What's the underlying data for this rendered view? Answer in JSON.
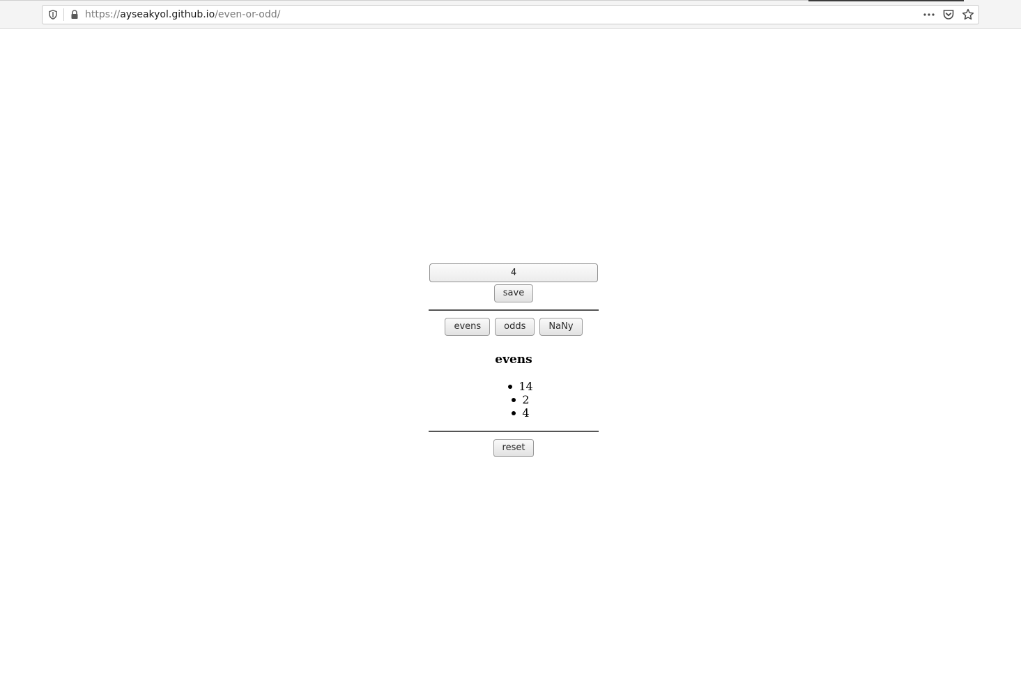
{
  "browser": {
    "url_scheme": "https://",
    "url_host": "ayseakyol.github.io",
    "url_path": "/even-or-odd/"
  },
  "app": {
    "input_value": "4",
    "save_label": "save",
    "filters": [
      {
        "label": "evens"
      },
      {
        "label": "odds"
      },
      {
        "label": "NaNy"
      }
    ],
    "list_title": "evens",
    "numbers": [
      "14",
      "2",
      "4"
    ],
    "reset_label": "reset"
  }
}
